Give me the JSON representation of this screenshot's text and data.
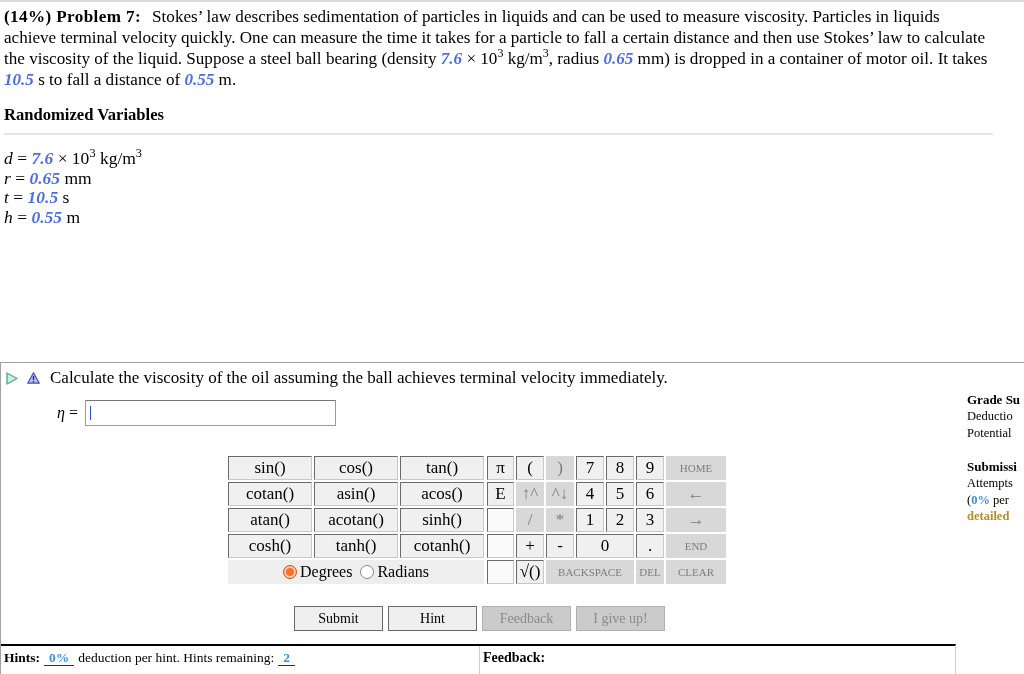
{
  "problem": {
    "heading": "(14%) Problem 7:",
    "segments": [
      {
        "kind": "text",
        "text": "Stokes’ law describes sedimentation of particles in liquids and can be used to measure viscosity. Particles in liquids achieve terminal velocity quickly. One can measure the time it takes for a particle to fall a certain distance and then use Stokes’ law to calculate the viscosity of the liquid. Suppose a steel ball bearing (density "
      },
      {
        "kind": "value",
        "text": "7.6"
      },
      {
        "kind": "text",
        "text": " × 10$^{3}$ kg/m$^{3}$, radius "
      },
      {
        "kind": "value",
        "text": "0.65"
      },
      {
        "kind": "text",
        "text": " mm) is dropped in a container of motor oil. It takes "
      },
      {
        "kind": "value",
        "text": "10.5"
      },
      {
        "kind": "text",
        "text": " s to fall a distance of "
      },
      {
        "kind": "value",
        "text": "0.55"
      },
      {
        "kind": "text",
        "text": " m."
      }
    ]
  },
  "randomized_variables": {
    "title": "Randomized Variables",
    "items": [
      {
        "label": "*d* =",
        "value": "7.6",
        "unit": "× 10$^{3}$ kg/m$^{3}$"
      },
      {
        "label": "*r* =",
        "value": "0.65",
        "unit": "mm"
      },
      {
        "label": "*t* =",
        "value": "10.5",
        "unit": "s"
      },
      {
        "label": "*h* =",
        "value": "0.55",
        "unit": "m"
      }
    ]
  },
  "question": {
    "text": "Calculate the viscosity of the oil assuming the ball achieves terminal velocity immediately.",
    "answer": {
      "label": "*η* =",
      "focused": true
    }
  },
  "calculator": {
    "functions": [
      [
        "sin()",
        "cos()",
        "tan()"
      ],
      [
        "cotan()",
        "asin()",
        "acos()"
      ],
      [
        "atan()",
        "acotan()",
        "sinh()"
      ],
      [
        "cosh()",
        "tanh()",
        "cotanh()"
      ]
    ],
    "angle_modes": [
      {
        "label": "Degrees",
        "selected": true
      },
      {
        "label": "Radians",
        "selected": false
      }
    ],
    "keypad": [
      [
        {
          "kind": "key",
          "label": "π",
          "disabled": false
        },
        {
          "kind": "key",
          "label": "(",
          "disabled": false
        },
        {
          "kind": "key",
          "label": ")",
          "disabled": true
        },
        {
          "kind": "key",
          "label": "7",
          "disabled": false
        },
        {
          "kind": "key",
          "label": "8",
          "disabled": false
        },
        {
          "kind": "key",
          "label": "9",
          "disabled": false
        },
        {
          "kind": "command",
          "label": "HOME",
          "disabled": true
        }
      ],
      [
        {
          "kind": "key",
          "label": "E",
          "disabled": false
        },
        {
          "kind": "key",
          "label": "↑^",
          "disabled": true
        },
        {
          "kind": "key",
          "label": "^↓",
          "disabled": true
        },
        {
          "kind": "key",
          "label": "4",
          "disabled": false
        },
        {
          "kind": "key",
          "label": "5",
          "disabled": false
        },
        {
          "kind": "key",
          "label": "6",
          "disabled": false
        },
        {
          "kind": "key",
          "label": "←",
          "disabled": true
        }
      ],
      [
        {
          "kind": "blank"
        },
        {
          "kind": "key",
          "label": "/",
          "disabled": true
        },
        {
          "kind": "key",
          "label": "*",
          "disabled": true
        },
        {
          "kind": "key",
          "label": "1",
          "disabled": false
        },
        {
          "kind": "key",
          "label": "2",
          "disabled": false
        },
        {
          "kind": "key",
          "label": "3",
          "disabled": false
        },
        {
          "kind": "key",
          "label": "→",
          "disabled": true
        }
      ],
      [
        {
          "kind": "blank"
        },
        {
          "kind": "key",
          "label": "+",
          "disabled": false
        },
        {
          "kind": "key",
          "label": "-",
          "disabled": false
        },
        {
          "kind": "double",
          "label": "0",
          "disabled": false
        },
        {
          "kind": "key",
          "label": ".",
          "disabled": false
        },
        {
          "kind": "command",
          "label": "END",
          "disabled": true
        }
      ],
      [
        {
          "kind": "blank"
        },
        {
          "kind": "key",
          "label": "√()",
          "disabled": false
        },
        {
          "kind": "long-command",
          "label": "BACKSPACE",
          "disabled": true
        },
        {
          "kind": "command",
          "label": "DEL",
          "disabled": true
        },
        {
          "kind": "command",
          "label": "CLEAR",
          "disabled": true
        }
      ]
    ]
  },
  "buttons": [
    {
      "label": "Submit",
      "disabled": false
    },
    {
      "label": "Hint",
      "disabled": false
    },
    {
      "label": "Feedback",
      "disabled": true
    },
    {
      "label": "I give up!",
      "disabled": true
    }
  ],
  "hints": {
    "label": "Hints:",
    "deduction": "0%",
    "text": "deduction per hint. Hints remaining:",
    "remaining": "2"
  },
  "feedback": {
    "label": "Feedback:"
  },
  "grade_summary": {
    "title": "Grade Su",
    "lines": [
      "Deductio",
      "Potential"
    ]
  },
  "submission_history": {
    "title": "Submissi",
    "lines": [
      {
        "kind": "text",
        "text": "Attempts"
      },
      {
        "kind": "text",
        "text": "(**0%** per"
      },
      {
        "kind": "link",
        "text": "detailed"
      }
    ]
  }
}
